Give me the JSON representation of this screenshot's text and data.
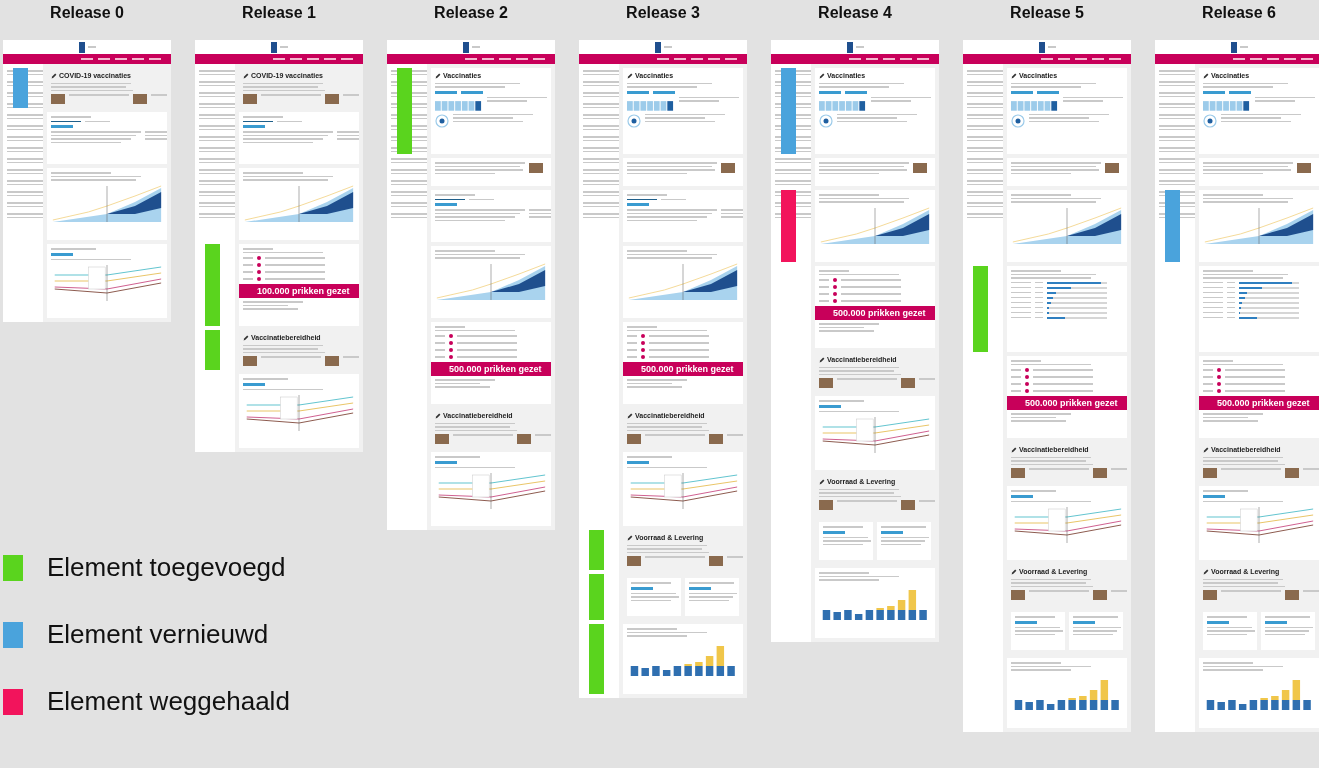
{
  "releases": [
    {
      "title": "Release 0",
      "sections": [
        {
          "kind": "intro",
          "title": "COVID-19 vaccinaties",
          "color": "#4aa3dc"
        },
        {
          "kind": "stat"
        },
        {
          "kind": "area"
        },
        {
          "kind": "line"
        }
      ]
    },
    {
      "title": "Release 1",
      "sections": [
        {
          "kind": "intro",
          "title": "COVID-19 vaccinaties"
        },
        {
          "kind": "stat"
        },
        {
          "kind": "area"
        },
        {
          "kind": "milestones",
          "banner": "100.000 prikken gezet",
          "color": "#5ad41e"
        },
        {
          "kind": "intro",
          "title": "Vaccinatiebereidheid",
          "color": "#5ad41e"
        },
        {
          "kind": "line"
        }
      ]
    },
    {
      "title": "Release 2",
      "sections": [
        {
          "kind": "overview",
          "title": "Vaccinaties",
          "color": "#5ad41e"
        },
        {
          "kind": "articles"
        },
        {
          "kind": "stat"
        },
        {
          "kind": "area"
        },
        {
          "kind": "milestones",
          "banner": "500.000 prikken gezet"
        },
        {
          "kind": "intro",
          "title": "Vaccinatiebereidheid"
        },
        {
          "kind": "line"
        }
      ]
    },
    {
      "title": "Release 3",
      "sections": [
        {
          "kind": "overview",
          "title": "Vaccinaties"
        },
        {
          "kind": "articles"
        },
        {
          "kind": "stat"
        },
        {
          "kind": "area"
        },
        {
          "kind": "milestones",
          "banner": "500.000 prikken gezet"
        },
        {
          "kind": "intro",
          "title": "Vaccinatiebereidheid"
        },
        {
          "kind": "line"
        },
        {
          "kind": "intro",
          "title": "Voorraad & Levering",
          "color": "#5ad41e"
        },
        {
          "kind": "twostats",
          "color": "#5ad41e"
        },
        {
          "kind": "bars",
          "color": "#5ad41e"
        }
      ]
    },
    {
      "title": "Release 4",
      "sections": [
        {
          "kind": "overview",
          "title": "Vaccinaties",
          "color": "#4aa3dc"
        },
        {
          "kind": "articles"
        },
        {
          "kind": "area",
          "color": "#f2145c"
        },
        {
          "kind": "milestones",
          "banner": "500.000 prikken gezet"
        },
        {
          "kind": "intro",
          "title": "Vaccinatiebereidheid"
        },
        {
          "kind": "line"
        },
        {
          "kind": "intro",
          "title": "Voorraad & Levering"
        },
        {
          "kind": "twostats"
        },
        {
          "kind": "bars"
        }
      ]
    },
    {
      "title": "Release 5",
      "sections": [
        {
          "kind": "overview",
          "title": "Vaccinaties"
        },
        {
          "kind": "articles"
        },
        {
          "kind": "area"
        },
        {
          "kind": "progress",
          "color": "#5ad41e",
          "rows": [
            {
              "level": 0.9
            },
            {
              "level": 0.4
            },
            {
              "level": 0.15
            },
            {
              "level": 0.1
            },
            {
              "level": 0.06
            },
            {
              "level": 0.04
            },
            {
              "level": 0.03
            },
            {
              "level": 0.3
            }
          ]
        },
        {
          "kind": "milestones",
          "banner": "500.000 prikken gezet"
        },
        {
          "kind": "intro",
          "title": "Vaccinatiebereidheid"
        },
        {
          "kind": "line"
        },
        {
          "kind": "intro",
          "title": "Voorraad & Levering"
        },
        {
          "kind": "twostats"
        },
        {
          "kind": "bars"
        }
      ]
    },
    {
      "title": "Release 6",
      "sections": [
        {
          "kind": "overview",
          "title": "Vaccinaties"
        },
        {
          "kind": "articles"
        },
        {
          "kind": "area",
          "color": "#4aa3dc"
        },
        {
          "kind": "progress",
          "rows": [
            {
              "level": 0.88
            },
            {
              "level": 0.38
            },
            {
              "level": 0.13
            },
            {
              "level": 0.1
            },
            {
              "level": 0.05
            },
            {
              "level": 0.03
            },
            {
              "level": 0.02
            },
            {
              "level": 0.3
            }
          ]
        },
        {
          "kind": "milestones",
          "banner": "500.000 prikken gezet"
        },
        {
          "kind": "intro",
          "title": "Vaccinatiebereidheid"
        },
        {
          "kind": "line"
        },
        {
          "kind": "intro",
          "title": "Voorraad & Levering"
        },
        {
          "kind": "twostats"
        },
        {
          "kind": "bars"
        }
      ]
    }
  ],
  "legend": [
    {
      "label": "Element toegevoegd",
      "color": "#5ad41e"
    },
    {
      "label": "Element vernieuwd",
      "color": "#4aa3dc"
    },
    {
      "label": "Element weggehaald",
      "color": "#f2145c"
    }
  ]
}
